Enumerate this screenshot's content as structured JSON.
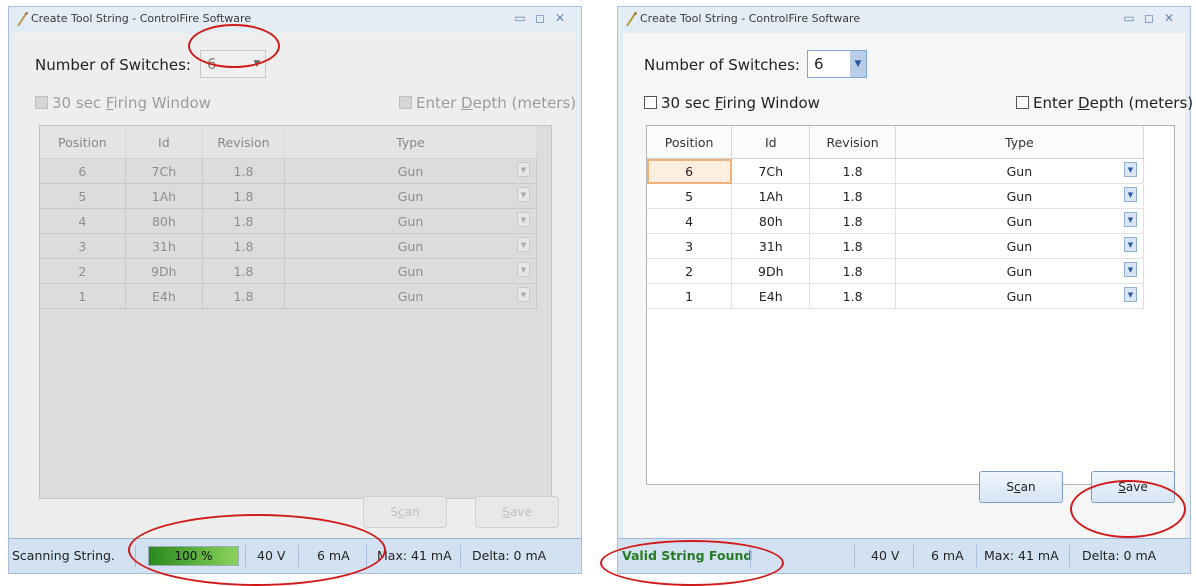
{
  "left_window": {
    "title": "Create Tool String - ControlFire Software",
    "window_controls": [
      "minimize-icon",
      "maximize-icon",
      "close-icon"
    ],
    "switches_label": "Number of Switches:",
    "switches_value": "6",
    "firing_window": {
      "prefix": "30 sec ",
      "accel": "F",
      "rest": "iring Window",
      "checked": false
    },
    "depth": {
      "prefix": "Enter ",
      "accel": "D",
      "rest": "epth (meters)",
      "checked": false
    },
    "columns": [
      "Position",
      "Id",
      "Revision",
      "Type"
    ],
    "rows": [
      {
        "position": "6",
        "id": "7Ch",
        "revision": "1.8",
        "type": "Gun"
      },
      {
        "position": "5",
        "id": "1Ah",
        "revision": "1.8",
        "type": "Gun"
      },
      {
        "position": "4",
        "id": "80h",
        "revision": "1.8",
        "type": "Gun"
      },
      {
        "position": "3",
        "id": "31h",
        "revision": "1.8",
        "type": "Gun"
      },
      {
        "position": "2",
        "id": "9Dh",
        "revision": "1.8",
        "type": "Gun"
      },
      {
        "position": "1",
        "id": "E4h",
        "revision": "1.8",
        "type": "Gun"
      }
    ],
    "scan_button": {
      "pre": "S",
      "accel": "c",
      "post": "an"
    },
    "save_button": {
      "accel": "S",
      "post": "ave"
    },
    "status": {
      "text": "Scanning String.",
      "progress": 1.0,
      "progress_label": "100 %",
      "voltage": "40 V",
      "current": "6 mA",
      "max": "Max: 41 mA",
      "delta": "Delta: 0 mA"
    },
    "state": "disabled"
  },
  "right_window": {
    "title": "Create Tool String - ControlFire Software",
    "window_controls": [
      "minimize-icon",
      "maximize-icon",
      "close-icon"
    ],
    "switches_label": "Number of Switches:",
    "switches_value": "6",
    "firing_window": {
      "prefix": "30 sec ",
      "accel": "F",
      "rest": "iring Window",
      "checked": false
    },
    "depth": {
      "prefix": "Enter ",
      "accel": "D",
      "rest": "epth (meters)",
      "checked": false
    },
    "columns": [
      "Position",
      "Id",
      "Revision",
      "Type"
    ],
    "rows": [
      {
        "position": "6",
        "id": "7Ch",
        "revision": "1.8",
        "type": "Gun"
      },
      {
        "position": "5",
        "id": "1Ah",
        "revision": "1.8",
        "type": "Gun"
      },
      {
        "position": "4",
        "id": "80h",
        "revision": "1.8",
        "type": "Gun"
      },
      {
        "position": "3",
        "id": "31h",
        "revision": "1.8",
        "type": "Gun"
      },
      {
        "position": "2",
        "id": "9Dh",
        "revision": "1.8",
        "type": "Gun"
      },
      {
        "position": "1",
        "id": "E4h",
        "revision": "1.8",
        "type": "Gun"
      }
    ],
    "selected_row": 0,
    "scan_button": {
      "pre": "S",
      "accel": "c",
      "post": "an"
    },
    "save_button": {
      "accel": "S",
      "post": "ave"
    },
    "status": {
      "text": "Valid String Found",
      "voltage": "40 V",
      "current": "6 mA",
      "max": "Max: 41 mA",
      "delta": "Delta: 0 mA"
    },
    "state": "enabled"
  },
  "annotation_color": "#d11a1a"
}
